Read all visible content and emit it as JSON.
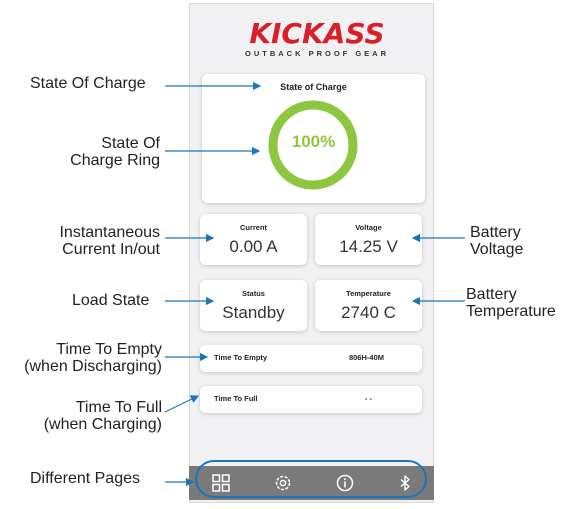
{
  "brand": {
    "name": "KICKASS",
    "tagline": "OUTBACK PROOF GEAR"
  },
  "soc": {
    "title": "State of Charge",
    "value": "100%",
    "percent": 100
  },
  "current": {
    "label": "Current",
    "value": "0.00 A"
  },
  "voltage": {
    "label": "Voltage",
    "value": "14.25 V"
  },
  "status": {
    "label": "Status",
    "value": "Standby"
  },
  "temperature": {
    "label": "Temperature",
    "value": "2740 C"
  },
  "time_to_empty": {
    "label": "Time To Empty",
    "value": "806H-40M"
  },
  "time_to_full": {
    "label": "Time To Full",
    "value": "- -"
  },
  "nav": [
    "dashboard-icon",
    "settings-icon",
    "info-icon",
    "bluetooth-icon"
  ],
  "callouts": {
    "state_of_charge": "State Of Charge",
    "ring_line1": "State Of",
    "ring_line2": "Charge Ring",
    "current_line1": "Instantaneous",
    "current_line2": "Current In/out",
    "load_state": "Load State",
    "tte_line1": "Time To Empty",
    "tte_line2": "(when Discharging)",
    "ttf_line1": "Time To Full",
    "ttf_line2": "(when Charging)",
    "pages": "Different Pages",
    "voltage_line1": "Battery",
    "voltage_line2": "Voltage",
    "temp_line1": "Battery",
    "temp_line2": "Temperature"
  },
  "colors": {
    "accent": "#1b75bb",
    "ring": "#8dc63f",
    "brand": "#d8202a",
    "navbar": "#7a7a7a"
  }
}
